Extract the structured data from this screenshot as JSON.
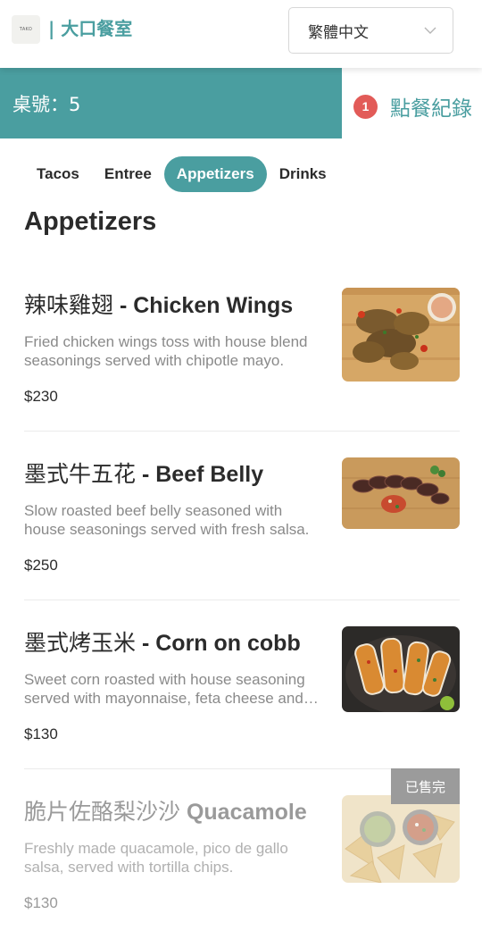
{
  "header": {
    "logo_text": "TAKO",
    "brand": "| 大口餐室",
    "language": {
      "selected": "繁體中文"
    }
  },
  "table_bar": {
    "label": "桌號：5",
    "orders_count": "1",
    "orders_label": "點餐紀錄"
  },
  "tabs": [
    {
      "label": "Tacos",
      "active": false
    },
    {
      "label": "Entree",
      "active": false
    },
    {
      "label": "Appetizers",
      "active": true
    },
    {
      "label": "Drinks",
      "active": false
    }
  ],
  "section_title": "Appetizers",
  "items": [
    {
      "name_zh": "辣味雞翅",
      "name_en": "- Chicken Wings",
      "description": "Fried chicken wings toss with house blend seasonings served with chipotle mayo.",
      "price": "$230",
      "photo_icon": "chicken-wings-photo"
    },
    {
      "name_zh": "墨式牛五花",
      "name_en": "- Beef Belly",
      "description": "Slow roasted beef belly seasoned with house seasonings served with fresh salsa.",
      "price": "$250",
      "photo_icon": "beef-belly-photo"
    },
    {
      "name_zh": "墨式烤玉米",
      "name_en": "- Corn on cobb",
      "description": "Sweet corn roasted with house seasoning served with mayonnaise, feta cheese and lime.",
      "price": "$130",
      "photo_icon": "corn-photo"
    },
    {
      "name_zh": "脆片佐酪梨沙沙",
      "name_en": "Quacamole",
      "description": "Freshly made quacamole, pico de gallo salsa, served with tortilla chips.",
      "price": "$130",
      "sold_out_label": "已售完",
      "photo_icon": "guacamole-photo"
    }
  ],
  "colors": {
    "accent": "#4a9ea0",
    "badge": "#e25b58",
    "soldout": "#9b9b9b"
  }
}
